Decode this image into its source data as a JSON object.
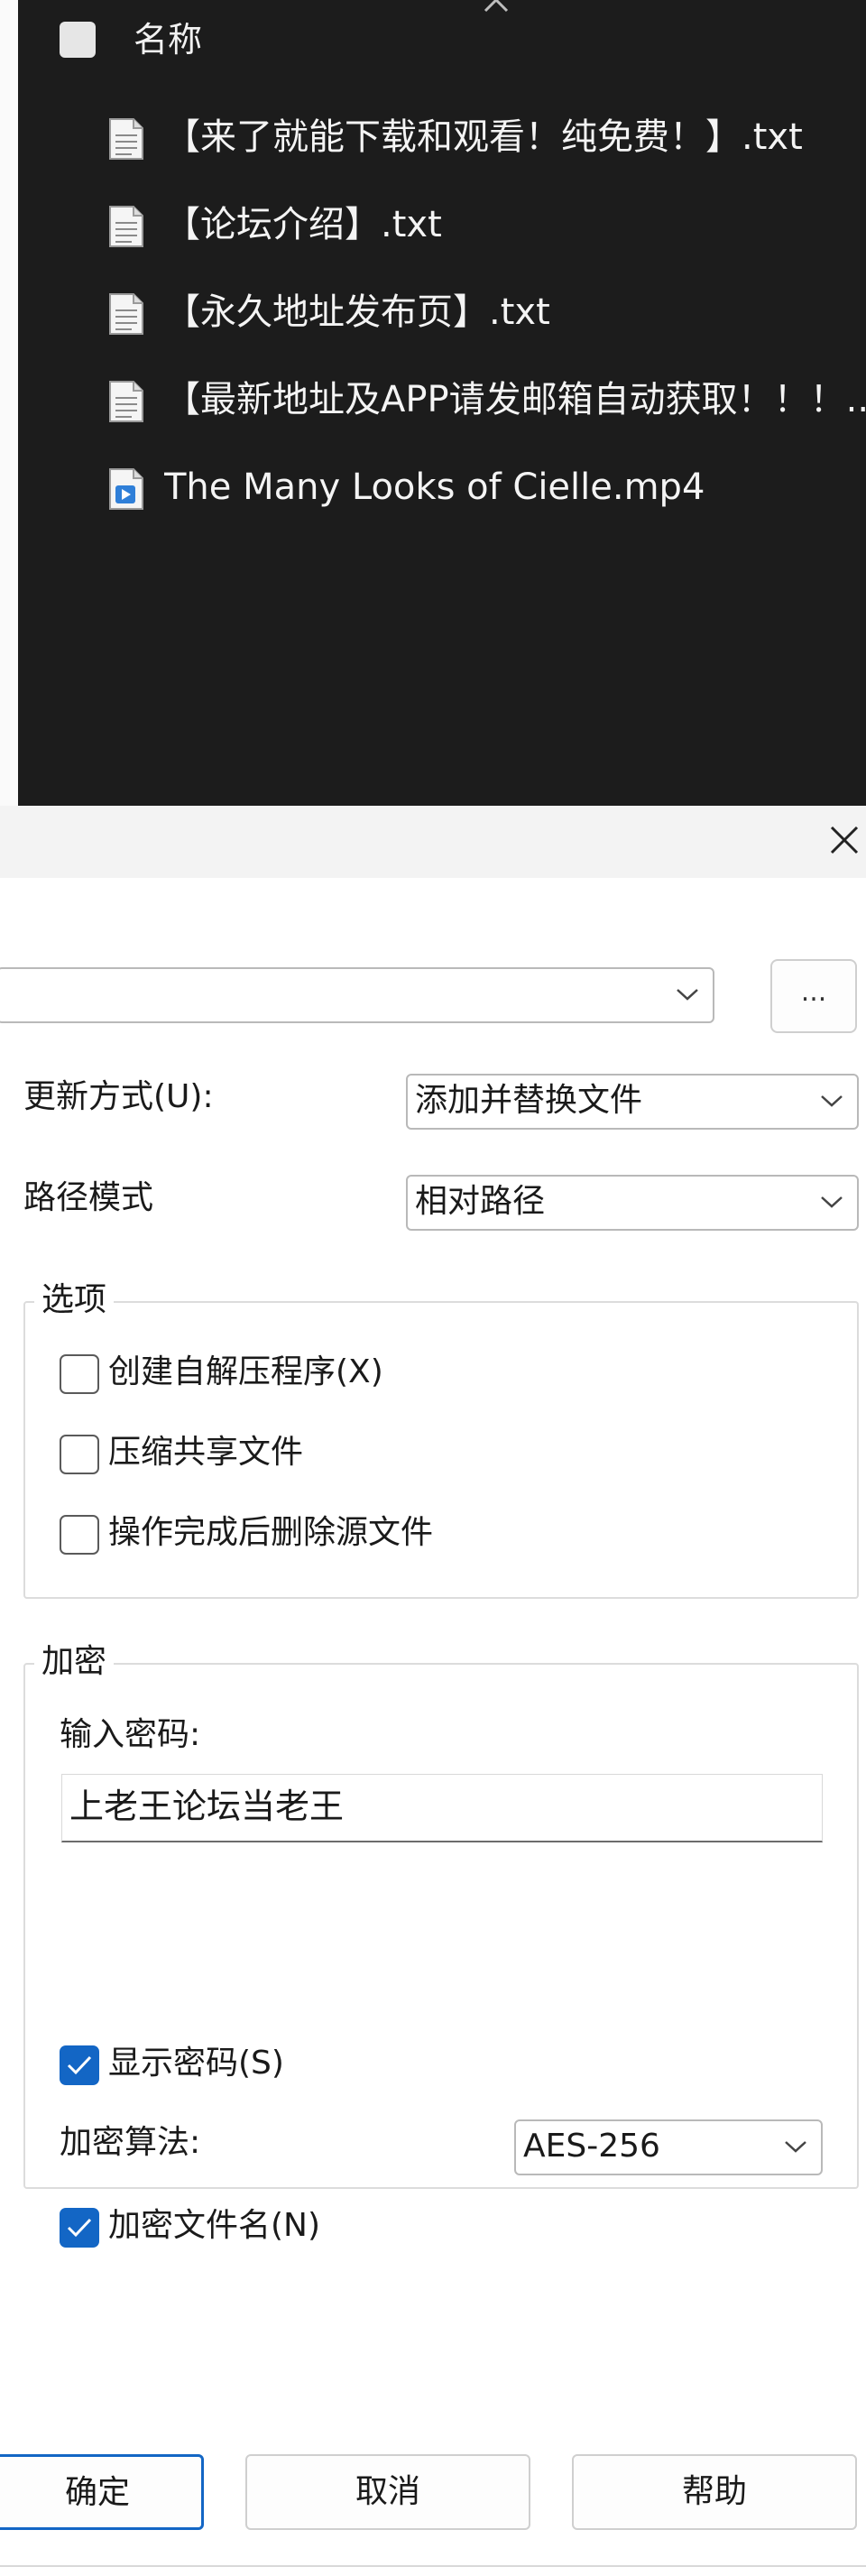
{
  "explorer": {
    "header_label": "名称",
    "files": [
      {
        "name": "【来了就能下载和观看！纯免费！】.txt",
        "icon": "text-file-icon"
      },
      {
        "name": "【论坛介绍】.txt",
        "icon": "text-file-icon"
      },
      {
        "name": "【永久地址发布页】.txt",
        "icon": "text-file-icon"
      },
      {
        "name": "【最新地址及APP请发邮箱自动获取！！！...",
        "icon": "text-file-icon"
      },
      {
        "name": "The Many Looks of Cielle.mp4",
        "icon": "video-file-icon"
      }
    ]
  },
  "dialog": {
    "browse_label": "...",
    "update_mode": {
      "label": "更新方式(U):",
      "value": "添加并替换文件"
    },
    "path_mode": {
      "label": "路径模式",
      "value": "相对路径"
    },
    "options": {
      "title": "选项",
      "items": [
        {
          "label": "创建自解压程序(X)",
          "checked": false
        },
        {
          "label": "压缩共享文件",
          "checked": false
        },
        {
          "label": "操作完成后删除源文件",
          "checked": false
        }
      ]
    },
    "encryption": {
      "title": "加密",
      "password_label": "输入密码:",
      "password_value": "上老王论坛当老王",
      "show_password": {
        "label": "显示密码(S)",
        "checked": true
      },
      "algorithm_label": "加密算法:",
      "algorithm_value": "AES-256",
      "encrypt_names": {
        "label": "加密文件名(N)",
        "checked": true
      }
    },
    "buttons": {
      "ok": "确定",
      "cancel": "取消",
      "help": "帮助"
    }
  },
  "colors": {
    "accent": "#1366c5",
    "explorer_bg": "#1c1c1c"
  }
}
